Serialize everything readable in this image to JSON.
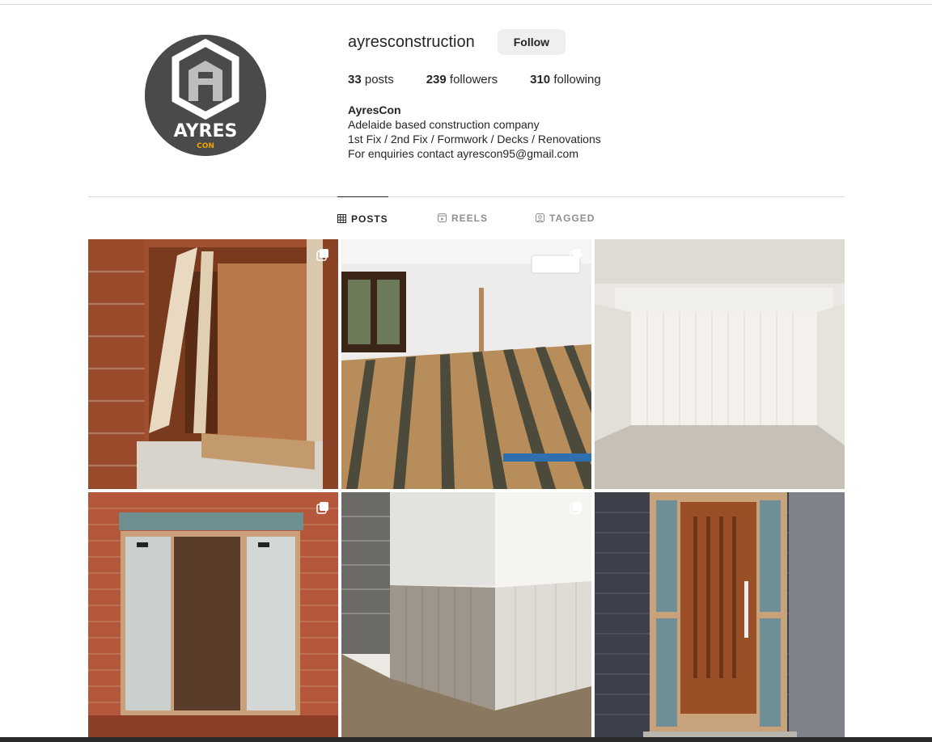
{
  "profile": {
    "username": "ayresconstruction",
    "follow_label": "Follow",
    "avatar_brand": "AYRES",
    "avatar_sub": "CON",
    "stats": {
      "posts_count": "33",
      "posts_label": "posts",
      "followers_count": "239",
      "followers_label": "followers",
      "following_count": "310",
      "following_label": "following"
    },
    "bio": {
      "name": "AyresCon",
      "line1": "Adelaide based construction company",
      "line2": "1st Fix / 2nd Fix / Formwork / Decks / Renovations",
      "line3": "For enquiries contact ayrescon95@gmail.com"
    }
  },
  "tabs": [
    {
      "label": "POSTS",
      "icon": "grid-icon",
      "active": true
    },
    {
      "label": "REELS",
      "icon": "reels-icon",
      "active": false
    },
    {
      "label": "TAGGED",
      "icon": "tagged-icon",
      "active": false
    }
  ],
  "colors": {
    "avatar_bg": "#4a4a4a",
    "avatar_accent": "#f0a500",
    "tab_active": "#262626",
    "tab_inactive": "#8e8e8e"
  }
}
